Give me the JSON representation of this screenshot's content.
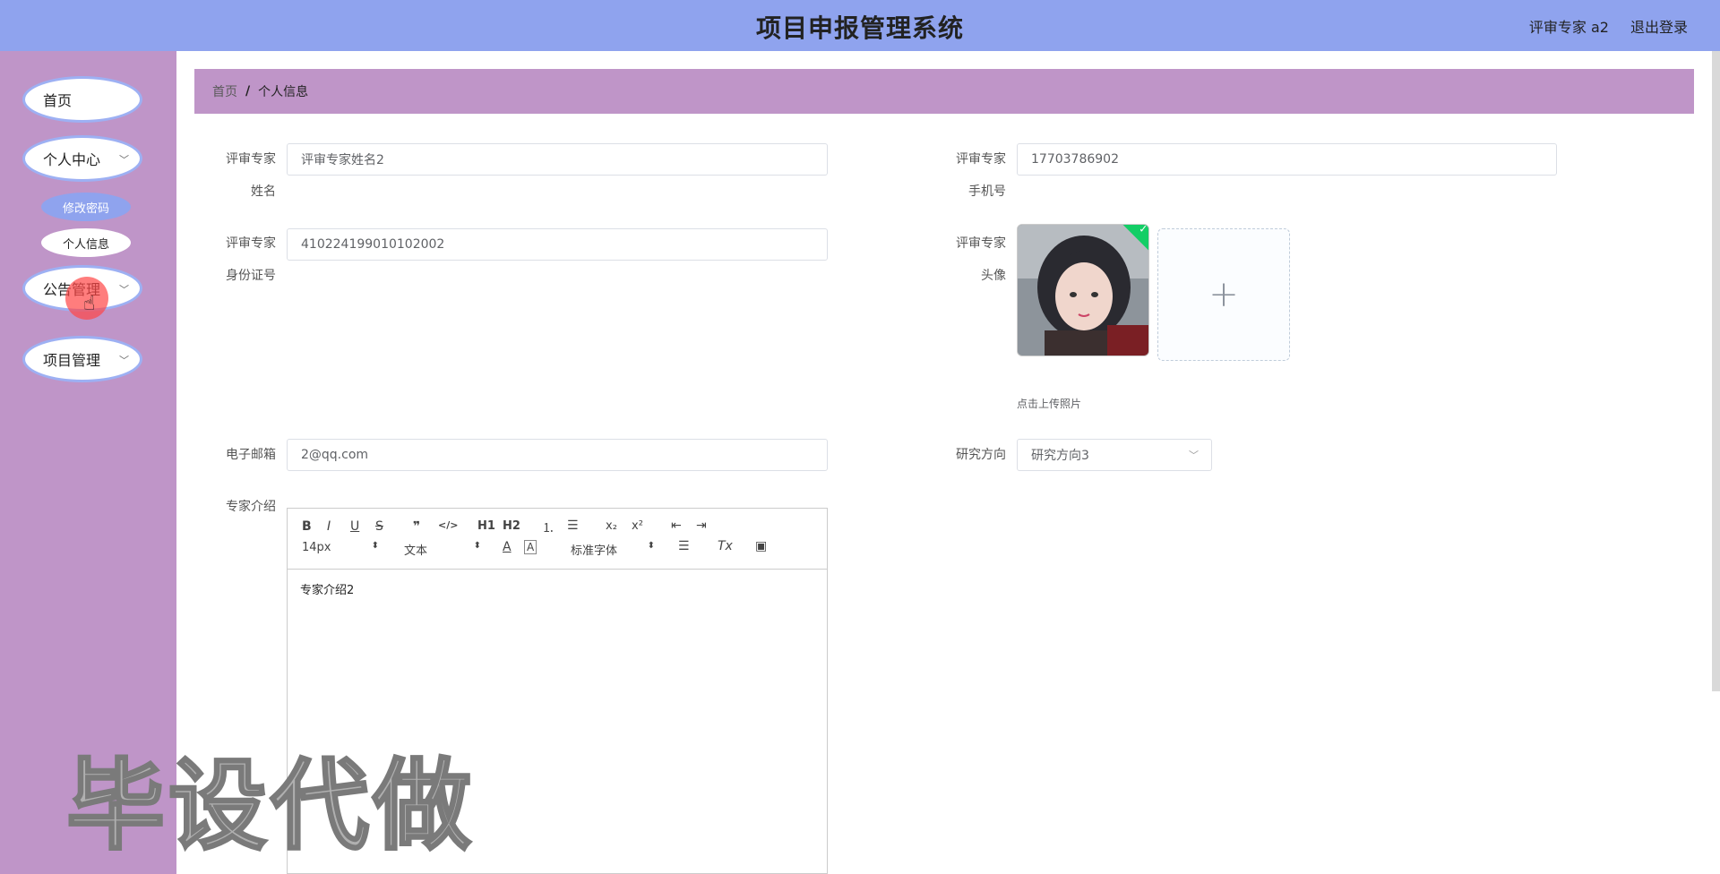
{
  "header": {
    "title": "项目申报管理系统",
    "user_label": "评审专家 a2",
    "logout_label": "退出登录"
  },
  "sidebar": {
    "items": [
      {
        "label": "首页"
      },
      {
        "label": "个人中心"
      },
      {
        "label": "公告管理"
      },
      {
        "label": "项目管理"
      }
    ],
    "personal_center_sub": [
      {
        "label": "修改密码"
      },
      {
        "label": "个人信息"
      }
    ]
  },
  "breadcrumb": {
    "home": "首页",
    "separator": "/",
    "current": "个人信息"
  },
  "form": {
    "name_label_1": "评审专家",
    "name_label_2": "姓名",
    "name_value": "评审专家姓名2",
    "phone_label_1": "评审专家",
    "phone_label_2": "手机号",
    "phone_value": "17703786902",
    "idcard_label_1": "评审专家",
    "idcard_label_2": "身份证号",
    "idcard_value": "410224199010102002",
    "avatar_label_1": "评审专家",
    "avatar_label_2": "头像",
    "upload_tip": "点击上传照片",
    "upload_plus": "+",
    "email_label": "电子邮箱",
    "email_value": "2@qq.com",
    "research_label": "研究方向",
    "research_value": "研究方向3",
    "intro_label": "专家介绍"
  },
  "editor": {
    "font_size": "14px",
    "header_type": "文本",
    "font_family": "标准字体",
    "content": "专家介绍2",
    "tools": [
      "B",
      "I",
      "U",
      "S",
      "❞",
      "</>",
      "H1",
      "H2"
    ]
  },
  "watermark": "毕设代做",
  "colors": {
    "header_bg": "#8fa3ee",
    "sidebar_bg": "#bf95c8",
    "success": "#13ce66"
  }
}
